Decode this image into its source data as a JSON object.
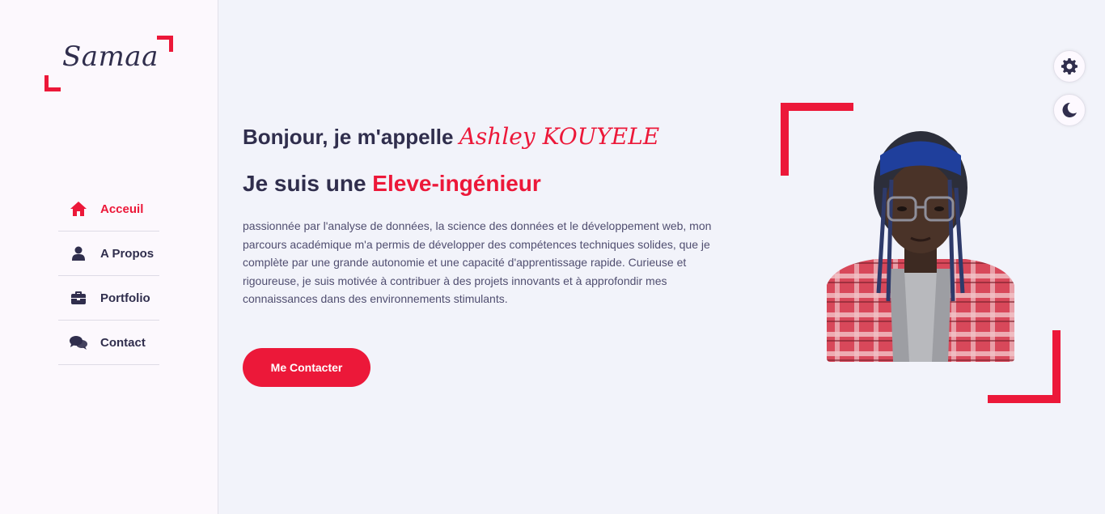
{
  "brand": {
    "logo_text": "Samaa"
  },
  "colors": {
    "accent": "#ec1839",
    "text": "#302e4d",
    "bg": "#f2f3fa",
    "sidebar_bg": "#fcf8fd"
  },
  "nav": {
    "items": [
      {
        "label": "Acceuil",
        "icon": "home-icon",
        "active": true
      },
      {
        "label": "A Propos",
        "icon": "user-icon",
        "active": false
      },
      {
        "label": "Portfolio",
        "icon": "briefcase-icon",
        "active": false
      },
      {
        "label": "Contact",
        "icon": "comments-icon",
        "active": false
      }
    ]
  },
  "hero": {
    "greeting_prefix": "Bonjour, je m'appelle",
    "name": "Ashley KOUYELE",
    "role_prefix": "Je suis une",
    "role": "Eleve-ingénieur",
    "description": "passionnée par l'analyse de données, la science des données et le développement web, mon parcours académique m'a permis de développer des compétences techniques solides, que je complète par une grande autonomie et une capacité d'apprentissage rapide. Curieuse et rigoureuse, je suis motivée à contribuer à des projets innovants et à approfondir mes connaissances dans des environnements stimulants.",
    "cta_label": "Me Contacter"
  },
  "controls": {
    "settings_icon": "gear-icon",
    "theme_icon": "moon-icon"
  }
}
